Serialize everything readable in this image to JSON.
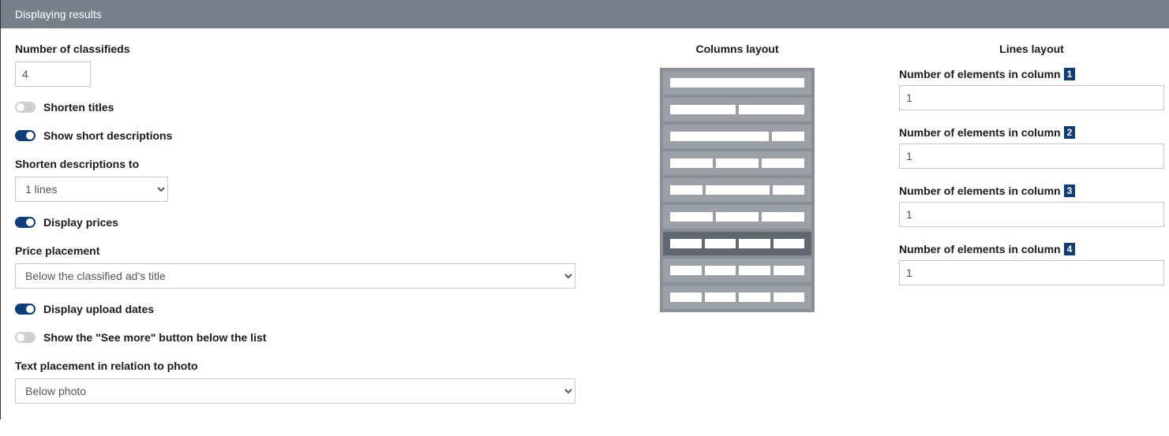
{
  "header": {
    "title": "Displaying results"
  },
  "left": {
    "number_of_classifieds_label": "Number of classifieds",
    "number_of_classifieds_value": "4",
    "shorten_titles_label": "Shorten titles",
    "show_short_descriptions_label": "Show short descriptions",
    "shorten_descriptions_to_label": "Shorten descriptions to",
    "shorten_descriptions_to_value": "1 lines",
    "display_prices_label": "Display prices",
    "price_placement_label": "Price placement",
    "price_placement_value": "Below the classified ad's title",
    "display_upload_dates_label": "Display upload dates",
    "see_more_label": "Show the \"See more\" button below the list",
    "text_placement_label": "Text placement in relation to photo",
    "text_placement_value": "Below photo"
  },
  "mid": {
    "heading": "Columns layout",
    "selected_index": 6,
    "rows": [
      {
        "cols": 1
      },
      {
        "cols": 2
      },
      {
        "cols": 2
      },
      {
        "cols": 3
      },
      {
        "cols": 3
      },
      {
        "cols": 3
      },
      {
        "cols": 4
      },
      {
        "cols": 4
      },
      {
        "cols": 4
      }
    ]
  },
  "right": {
    "heading": "Lines layout",
    "label_prefix": "Number of elements in column",
    "items": [
      {
        "badge": "1",
        "value": "1"
      },
      {
        "badge": "2",
        "value": "1"
      },
      {
        "badge": "3",
        "value": "1"
      },
      {
        "badge": "4",
        "value": "1"
      }
    ]
  }
}
